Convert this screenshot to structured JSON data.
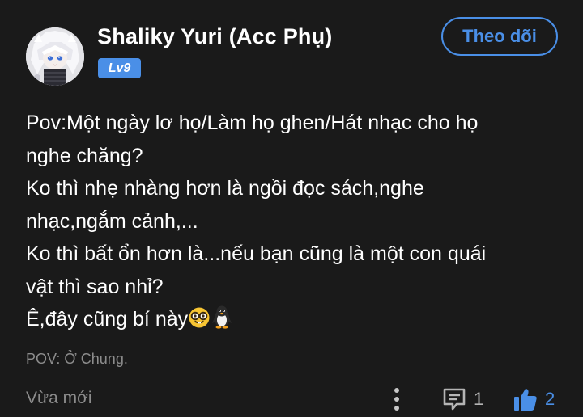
{
  "user": {
    "name": "Shaliky Yuri (Acc Phụ)",
    "level": "Lv9"
  },
  "follow_button": {
    "label": "Theo dõi"
  },
  "post": {
    "lines": [
      "Pov:Một ngày lơ họ/Làm họ ghen/Hát nhạc cho họ",
      "nghe chăng?",
      "Ko thì nhẹ nhàng hơn là ngồi đọc sách,nghe",
      "nhạc,ngắm cảnh,...",
      "Ko thì bất ổn hơn là...nếu bạn cũng là một con quái",
      "vật thì sao nhỉ?",
      "Ê,đây cũng bí này"
    ],
    "emojis": [
      "nerd-face-icon",
      "penguin-icon"
    ],
    "location": "POV: Ở Chung.",
    "timestamp": "Vừa mới"
  },
  "actions": {
    "comment_count": "1",
    "like_count": "2"
  },
  "colors": {
    "background": "#1a1a1a",
    "accent": "#4a8fe7",
    "muted_text": "#8c8c8c"
  }
}
